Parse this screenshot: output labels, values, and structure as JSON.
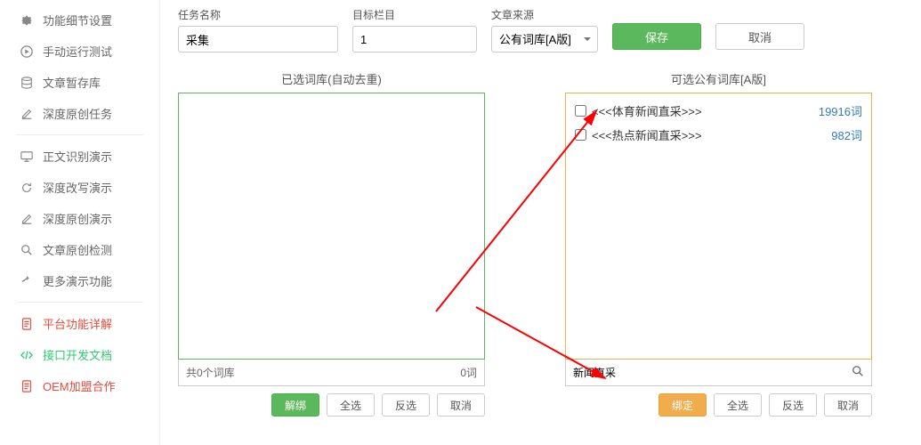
{
  "sidebar": {
    "items": [
      {
        "label": "功能细节设置"
      },
      {
        "label": "手动运行测试"
      },
      {
        "label": "文章暂存库"
      },
      {
        "label": "深度原创任务"
      },
      {
        "label": "正文识别演示"
      },
      {
        "label": "深度改写演示"
      },
      {
        "label": "深度原创演示"
      },
      {
        "label": "文章原创检测"
      },
      {
        "label": "更多演示功能"
      },
      {
        "label": "平台功能详解"
      },
      {
        "label": "接口开发文档"
      },
      {
        "label": "OEM加盟合作"
      }
    ]
  },
  "form": {
    "task_name_label": "任务名称",
    "task_name_value": "采集",
    "target_col_label": "目标栏目",
    "target_col_value": "1",
    "source_label": "文章来源",
    "source_value": "公有词库[A版]",
    "save": "保存",
    "cancel": "取消"
  },
  "left_panel": {
    "title": "已选词库(自动去重)",
    "foot_left": "共0个词库",
    "foot_right": "0词",
    "unbind": "解绑",
    "select_all": "全选",
    "invert": "反选",
    "cancel2": "取消"
  },
  "right_panel": {
    "title": "可选公有词库[A版]",
    "items": [
      {
        "label": "<<<体育新闻直采>>>",
        "count": "19916词"
      },
      {
        "label": "<<<热点新闻直采>>>",
        "count": "982词"
      }
    ],
    "search_value": "新闻直采",
    "bind": "绑定",
    "select_all": "全选",
    "invert": "反选",
    "cancel2": "取消"
  }
}
